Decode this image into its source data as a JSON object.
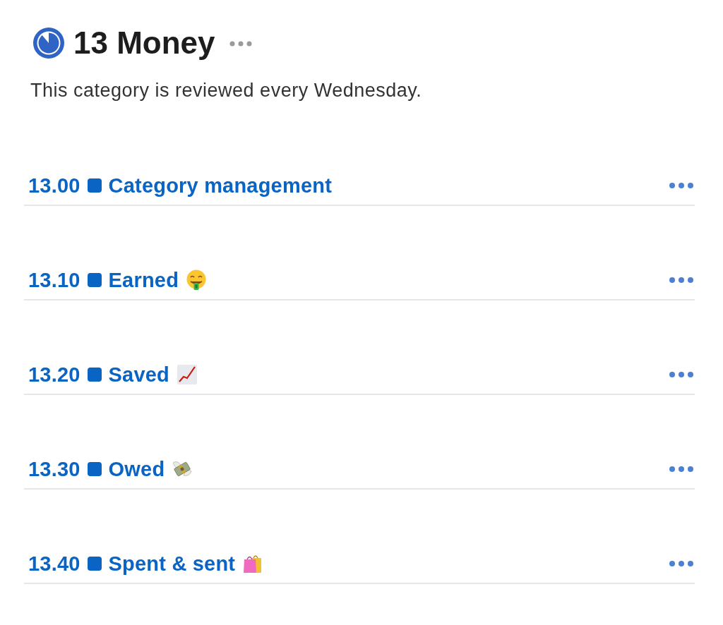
{
  "header": {
    "title": "13 Money",
    "description": "This category is reviewed every Wednesday."
  },
  "areas": [
    {
      "number": "13.00",
      "title": "Category management",
      "kind": "plain"
    },
    {
      "number": "13.10",
      "title": "Earned",
      "kind": "face"
    },
    {
      "number": "13.20",
      "title": "Saved",
      "kind": "chart"
    },
    {
      "number": "13.30",
      "title": "Owed",
      "kind": "cash"
    },
    {
      "number": "13.40",
      "title": "Spent & sent",
      "kind": "bags"
    }
  ]
}
